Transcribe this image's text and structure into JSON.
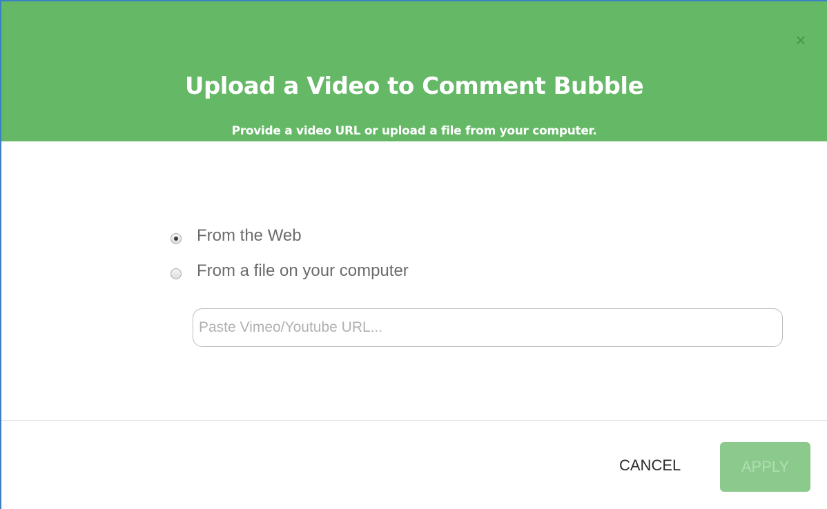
{
  "dialog": {
    "title": "Upload a Video to Comment Bubble",
    "subtitle": "Provide a video URL or upload a file from your computer.",
    "close_label": "×"
  },
  "source_options": [
    {
      "label": "From the Web",
      "checked": true
    },
    {
      "label": "From a file on your computer",
      "checked": false
    }
  ],
  "url_input": {
    "value": "",
    "placeholder": "Paste Vimeo/Youtube URL..."
  },
  "footer": {
    "cancel_label": "CANCEL",
    "apply_label": "APPLY",
    "apply_disabled": true
  },
  "colors": {
    "header_bg": "#64b866",
    "apply_bg": "#8bc98d"
  }
}
